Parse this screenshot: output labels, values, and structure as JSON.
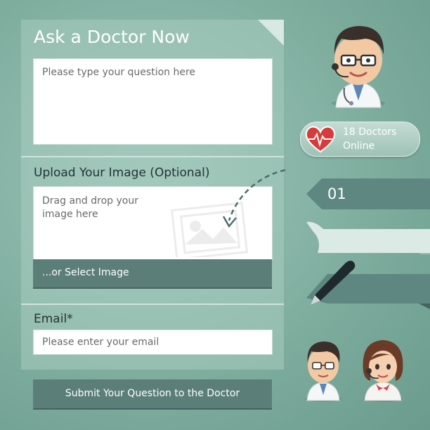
{
  "form": {
    "title": "Ask a Doctor Now",
    "question_placeholder": "Please type your question here",
    "upload_label": "Upload Your Image (Optional)",
    "dropzone_text_line1": "Drag and drop your",
    "dropzone_text_line2": "image here",
    "select_image_label": "...or Select Image",
    "email_label": "Email*",
    "email_placeholder": "Please enter your email",
    "submit_label": "Submit Your Question to the Doctor"
  },
  "status": {
    "online_text_line1": "18 Doctors",
    "online_text_line2": "Online"
  },
  "steps": {
    "step1_number": "01"
  },
  "colors": {
    "background": "#7fae9f",
    "panel": "#a8ccc0",
    "bar": "#5c7e79",
    "heart": "#d83b3b"
  }
}
